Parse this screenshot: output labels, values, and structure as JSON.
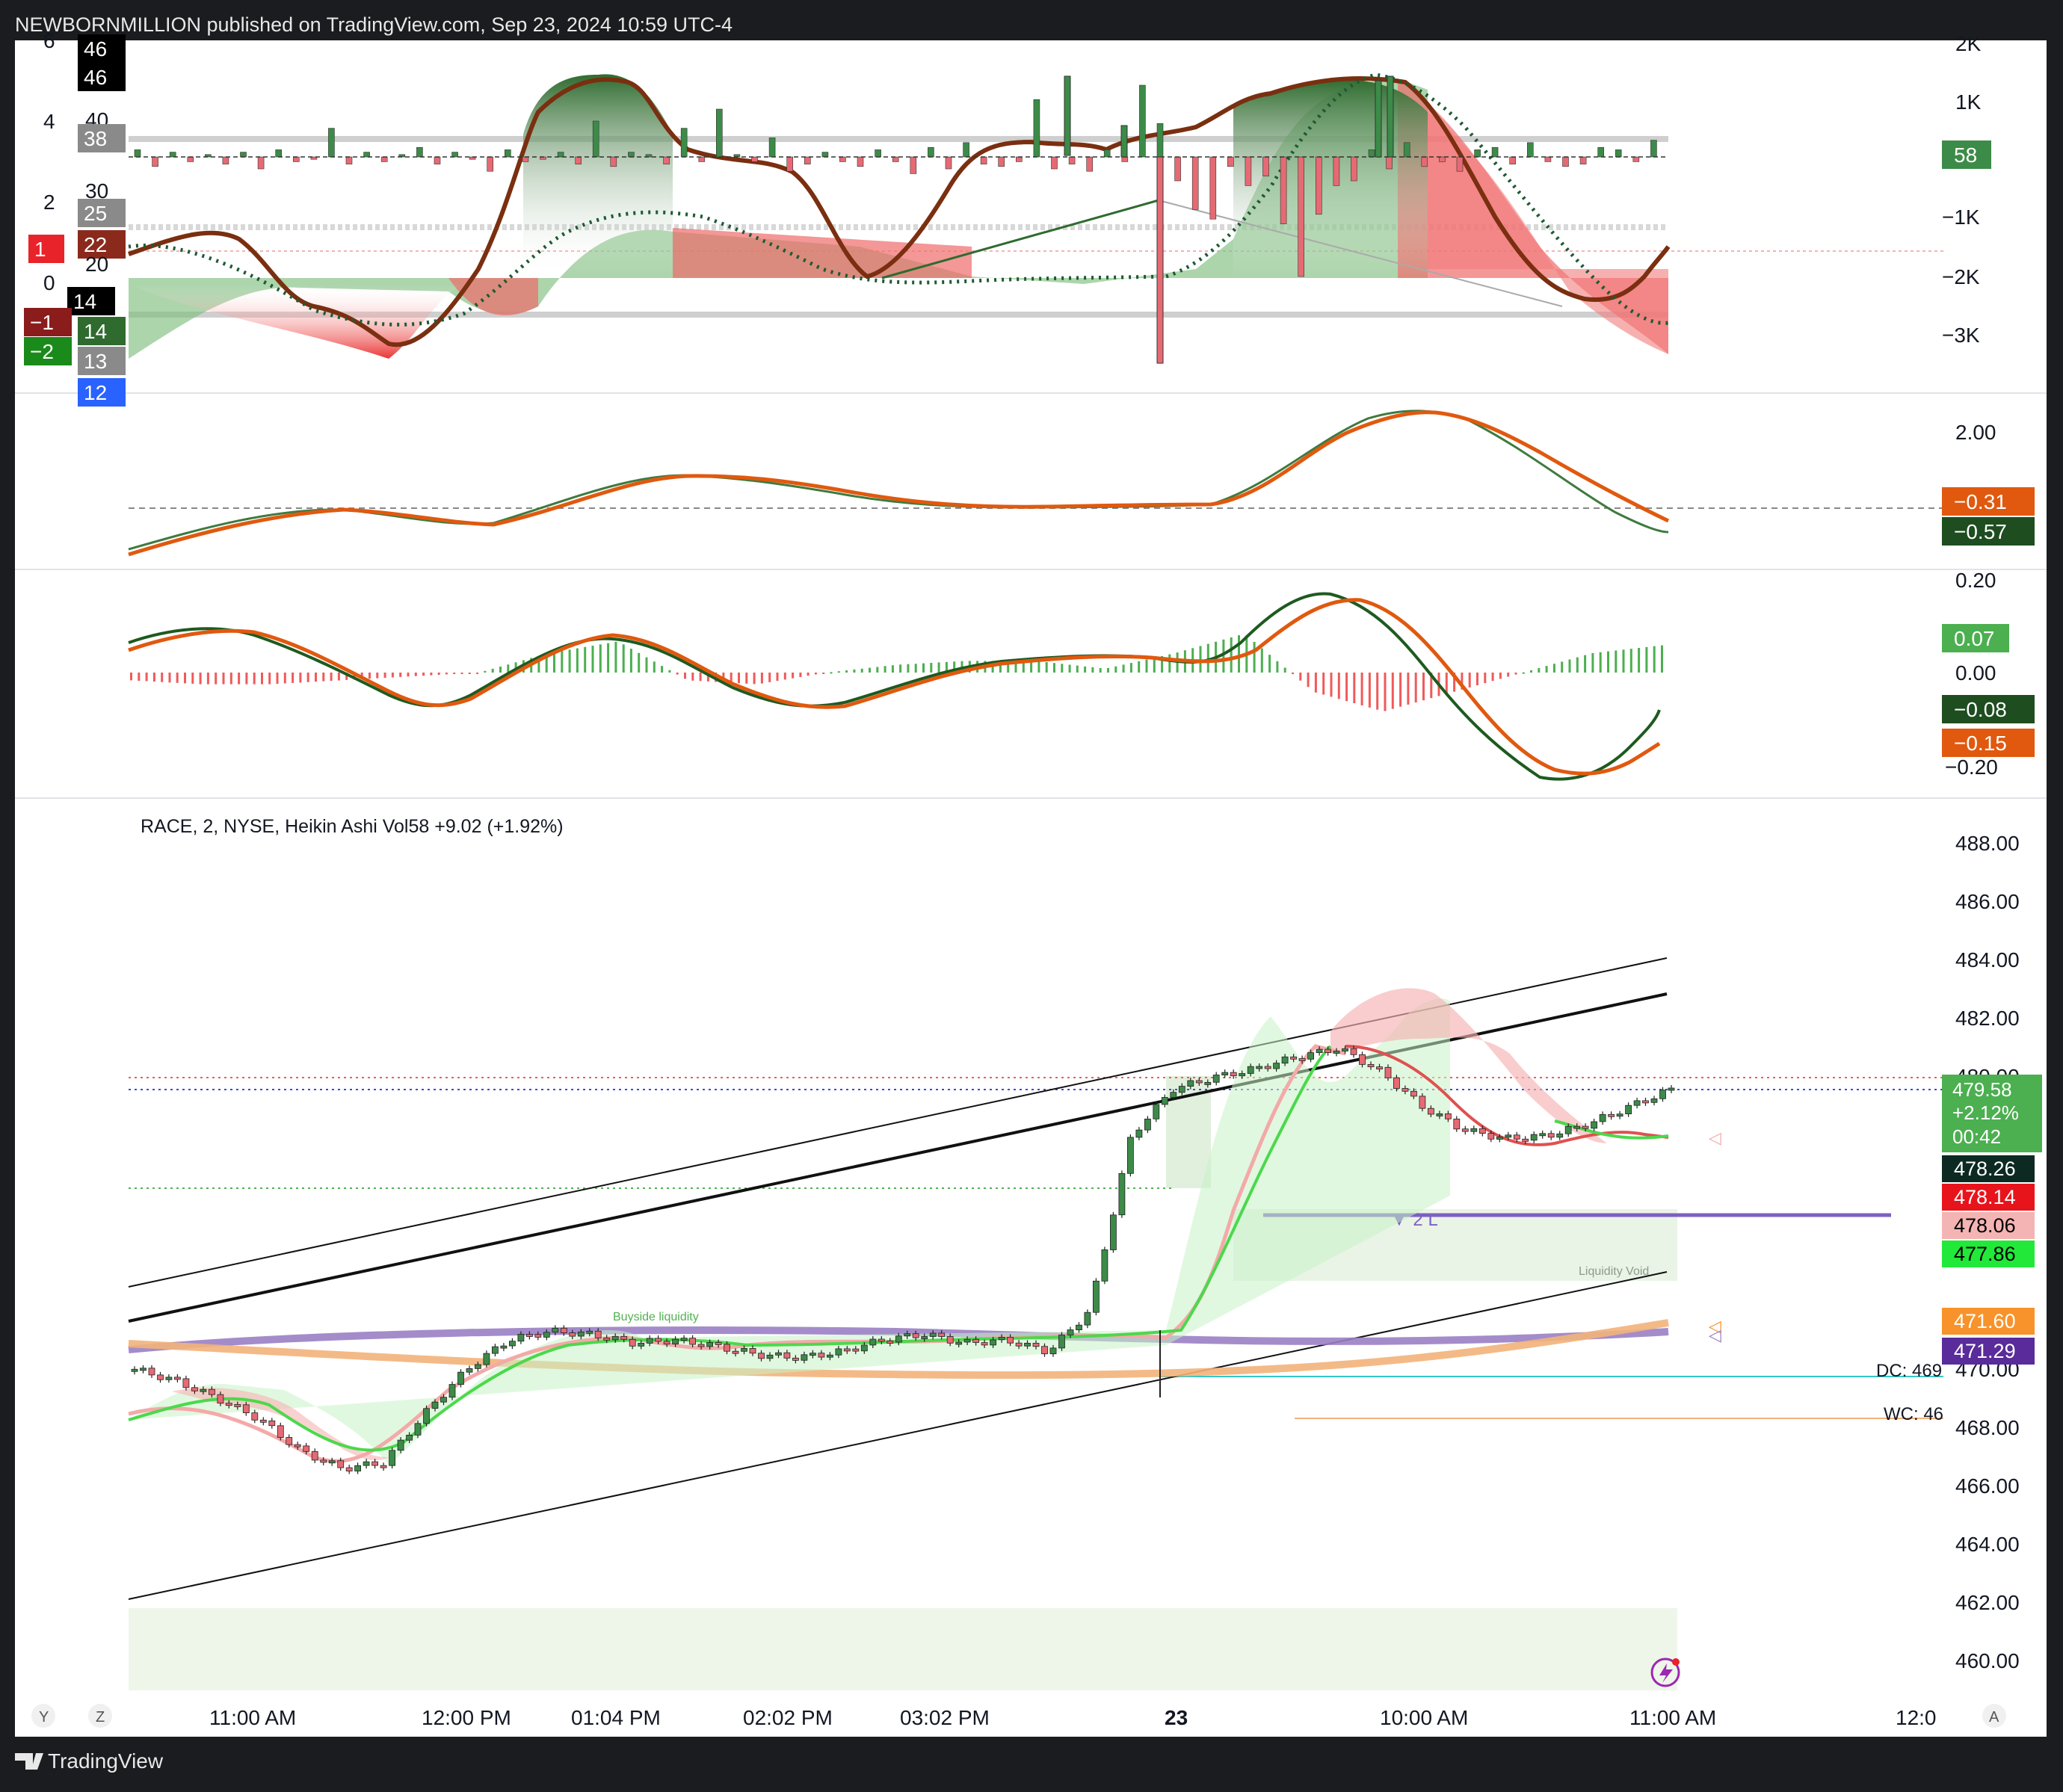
{
  "header": {
    "publisher_line": "NEWBORNMILLION published on TradingView.com, Sep 23, 2024 10:59 UTC-4"
  },
  "footer": {
    "brand": "TradingView"
  },
  "symbol_line": "RACE, 2, NYSE, Heikin Ashi  Vol58  +9.02 (+1.92%)",
  "time_axis": {
    "labels": [
      "11:00 AM",
      "12:00 PM",
      "01:04 PM",
      "02:02 PM",
      "03:02 PM",
      "23",
      "10:00 AM",
      "11:00 AM",
      "12:0"
    ],
    "scale_buttons": [
      "Y",
      "Z",
      "A"
    ]
  },
  "colors": {
    "bull": "#3c8b48",
    "bear": "#e66a73",
    "macd_fast": "#2e6b34",
    "macd_slow": "#e0590f",
    "ma_purple": "#9a7fc4",
    "ma_orange": "#f2b27a",
    "cyan_line": "#33c7c9"
  },
  "panel1": {
    "left_axis": [
      "6",
      "4",
      "2",
      "0"
    ],
    "left_badges": [
      {
        "text": "46",
        "bg": "#000000"
      },
      {
        "text": "46",
        "bg": "#000000"
      },
      {
        "text": "40",
        "bg": ""
      },
      {
        "text": "38",
        "bg": "#8a8a8a"
      },
      {
        "text": "30",
        "bg": ""
      },
      {
        "text": "25",
        "bg": "#8a8a8a"
      },
      {
        "text": "22",
        "bg": "#8b2a1c"
      },
      {
        "text": "20",
        "bg": ""
      },
      {
        "text": "14",
        "bg": "#000000"
      },
      {
        "text": "14",
        "bg": "#2f6b2f"
      },
      {
        "text": "13",
        "bg": "#8a8a8a"
      },
      {
        "text": "12",
        "bg": "#2962ff"
      },
      {
        "text": "1",
        "bg": "#e8232a"
      },
      {
        "text": "−1",
        "bg": "#8b1c1c"
      },
      {
        "text": "−2",
        "bg": "#1a8a1a"
      }
    ],
    "right_axis": [
      "2K",
      "1K",
      "−1K",
      "−2K",
      "−3K"
    ],
    "right_badge": "58"
  },
  "panel2": {
    "right_axis": [
      "2.00"
    ],
    "badges": [
      "−0.31",
      "−0.57"
    ]
  },
  "panel3": {
    "right_axis": [
      "0.20",
      "0.00",
      "−0.20"
    ],
    "badges": [
      "0.07",
      "−0.08",
      "−0.15"
    ]
  },
  "price_panel": {
    "right_axis": [
      "488.00",
      "486.00",
      "484.00",
      "482.00",
      "480.00",
      "470.00",
      "468.00",
      "466.00",
      "464.00",
      "462.00",
      "460.00"
    ],
    "last_price_badge": [
      "479.58",
      "+2.12%",
      "00:42"
    ],
    "level_badges": [
      {
        "text": "478.26",
        "bg": "#0c2a22",
        "fg": "#ffffff"
      },
      {
        "text": "478.14",
        "bg": "#e8141b",
        "fg": "#ffffff"
      },
      {
        "text": "478.06",
        "bg": "#f4b4b4",
        "fg": "#000000"
      },
      {
        "text": "477.86",
        "bg": "#22e83a",
        "fg": "#000000"
      },
      {
        "text": "471.60",
        "bg": "#f7932a",
        "fg": "#ffffff"
      },
      {
        "text": "471.29",
        "bg": "#5a2b9a",
        "fg": "#ffffff"
      }
    ],
    "annotations": {
      "buyside": "Buyside liquidity",
      "liquidity_void": "Liquidity Void",
      "two_l": "▼ 2 L",
      "dc": "DC: 469",
      "wc": "WC: 46"
    }
  },
  "chart_data": [
    {
      "type": "line",
      "title": "",
      "note_series": "oscillator panel with volume histogram",
      "series": [
        {
          "values": [
            0.2,
            0.5,
            0.3,
            -1.5,
            -2.2,
            -0.8,
            2.5,
            5.3,
            5.4,
            3.6,
            3.0,
            2.2,
            -0.6,
            -0.2,
            1.8,
            2.1,
            0.9,
            0.2,
            0.8,
            4.8,
            5.1,
            5.3,
            4.9,
            3.0,
            0.2,
            0.5,
            -0.4,
            -0.3,
            0.2
          ]
        }
      ],
      "right_ylim": [
        -3000,
        2000
      ]
    },
    {
      "type": "line",
      "title": "",
      "series": [
        {
          "values": [
            -0.55,
            -0.35,
            0.0,
            0.1,
            0.0,
            0.45,
            0.65,
            0.45,
            0.25,
            0.15,
            0.1,
            0.15,
            0.25,
            1.2,
            2.2,
            2.3,
            1.6,
            0.4,
            -0.57
          ]
        },
        {
          "values": [
            -0.6,
            -0.4,
            -0.05,
            0.05,
            0.05,
            0.35,
            0.6,
            0.5,
            0.3,
            0.15,
            0.1,
            0.1,
            0.15,
            0.9,
            2.0,
            2.3,
            1.8,
            0.6,
            -0.31
          ]
        }
      ],
      "ylim": [
        -1.0,
        2.6
      ]
    },
    {
      "type": "line",
      "title": "",
      "histogram": [
        -0.02,
        -0.03,
        -0.03,
        -0.02,
        -0.01,
        0.0,
        0.05,
        0.08,
        -0.02,
        -0.03,
        0.0,
        0.02,
        0.03,
        0.03,
        0.01,
        0.05,
        0.1,
        -0.05,
        -0.1,
        -0.05,
        0.0,
        0.05,
        0.07
      ],
      "series": [
        {
          "values": [
            0.05,
            0.1,
            0.05,
            -0.05,
            -0.1,
            0.0,
            0.1,
            0.0,
            -0.1,
            -0.05,
            0.0,
            0.05,
            0.03,
            0.18,
            0.2,
            0.0,
            -0.15,
            -0.3,
            -0.2,
            -0.08
          ]
        },
        {
          "values": [
            0.06,
            0.09,
            0.06,
            -0.03,
            -0.09,
            -0.02,
            0.09,
            0.02,
            -0.09,
            -0.05,
            0.0,
            0.04,
            0.04,
            0.12,
            0.22,
            0.05,
            -0.12,
            -0.27,
            -0.22,
            -0.15
          ]
        }
      ],
      "ylim": [
        -0.27,
        0.27
      ]
    },
    {
      "type": "line",
      "title": "RACE, 2, NYSE, Heikin Ashi",
      "candles_close": [
        470.0,
        469.6,
        469.0,
        468.3,
        467.2,
        466.6,
        466.8,
        468.5,
        470.0,
        471.0,
        471.3,
        471.2,
        470.9,
        471.0,
        470.8,
        470.5,
        470.4,
        470.6,
        471.0,
        471.2,
        470.9,
        471.0,
        470.6,
        472.0,
        478.0,
        479.6,
        480.0,
        480.3,
        480.7,
        481.0,
        480.2,
        479.0,
        478.2,
        477.9,
        478.0,
        478.4,
        479.0,
        479.58
      ],
      "series": [
        {
          "name": "",
          "values": [
            471.4,
            471.5,
            471.6,
            471.7,
            471.7,
            471.6,
            471.5,
            471.4,
            471.3,
            471.3
          ]
        },
        {
          "name": "",
          "values": [
            471.4,
            471.0,
            470.6,
            470.3,
            470.2,
            470.1,
            470.2,
            470.4,
            471.0,
            471.6
          ]
        }
      ],
      "ylim": [
        459.0,
        489.0
      ]
    }
  ]
}
